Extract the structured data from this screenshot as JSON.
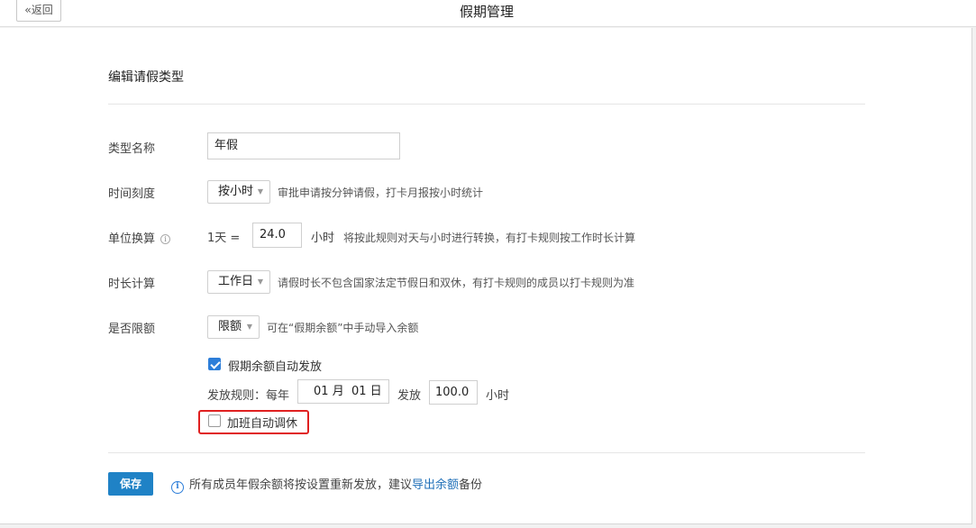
{
  "header": {
    "back_label": "返回",
    "back_icon": "double-chevron-left-icon",
    "title": "假期管理"
  },
  "form": {
    "section_title": "编辑请假类型",
    "type_name": {
      "label": "类型名称",
      "value": "年假"
    },
    "time_scale": {
      "label": "时间刻度",
      "selected": "按小时",
      "hint": "审批申请按分钟请假，打卡月报按小时统计"
    },
    "unit_conversion": {
      "label": "单位换算",
      "prefix": "1天 =",
      "value": "24.0",
      "unit": "小时",
      "hint": "将按此规则对天与小时进行转换，有打卡规则按工作时长计算"
    },
    "duration_calc": {
      "label": "时长计算",
      "selected": "工作日",
      "hint": "请假时长不包含国家法定节假日和双休，有打卡规则的成员以打卡规则为准"
    },
    "limit": {
      "label": "是否限额",
      "selected": "限额",
      "hint": "可在“假期余额”中手动导入余额"
    },
    "auto_issue": {
      "label": "假期余额自动发放",
      "checked": true
    },
    "issue_rule": {
      "label": "发放规则：每年",
      "month": "01",
      "month_unit": "月",
      "day": "01",
      "day_unit": "日",
      "issue_label": "发放",
      "amount": "100.0",
      "amount_unit": "小时"
    },
    "overtime_leave": {
      "label": "加班自动调休",
      "checked": false
    }
  },
  "footer": {
    "save_label": "保存",
    "notice_text": "所有成员年假余额将按设置重新发放，建议",
    "notice_link": "导出余额",
    "notice_suffix": "备份"
  },
  "colors": {
    "accent": "#1f82c6",
    "highlight": "#e02020"
  }
}
